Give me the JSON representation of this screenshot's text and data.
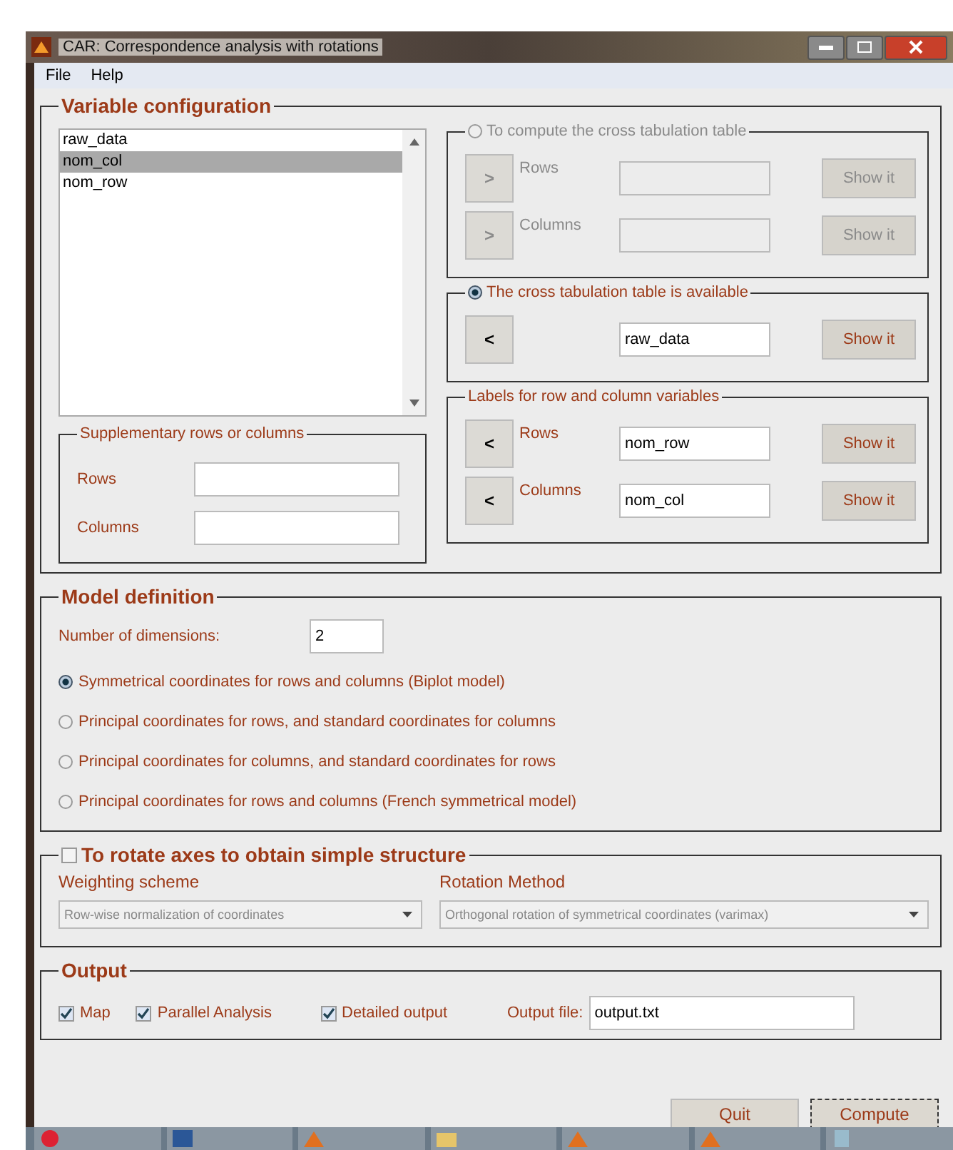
{
  "window": {
    "title": "CAR: Correspondence analysis with rotations"
  },
  "menu": [
    "File",
    "Help"
  ],
  "variable_configuration": {
    "title": "Variable configuration",
    "variables": [
      {
        "name": "raw_data",
        "selected": false
      },
      {
        "name": "nom_col",
        "selected": true
      },
      {
        "name": "nom_row",
        "selected": false
      }
    ],
    "supplementary": {
      "title": "Supplementary rows or columns",
      "fields": [
        {
          "label": "Rows"
        },
        {
          "label": "Columns"
        }
      ]
    },
    "compute_table": {
      "title": "To compute the cross tabulation table",
      "selected": false,
      "rows": [
        {
          "arrow": ">",
          "label": "Rows",
          "button": "Show it"
        },
        {
          "arrow": ">",
          "label": "Columns",
          "button": "Show it"
        }
      ]
    },
    "available_table": {
      "title": "The cross tabulation table is available",
      "selected": true,
      "arrow": "<",
      "value": "raw_data",
      "button": "Show it"
    },
    "labels": {
      "title": "Labels for row and column variables",
      "rows": [
        {
          "arrow": "<",
          "label": "Rows",
          "value": "nom_row",
          "button": "Show it"
        },
        {
          "arrow": "<",
          "label": "Columns",
          "value": "nom_col",
          "button": "Show it"
        }
      ]
    }
  },
  "model_definition": {
    "title": "Model definition",
    "dimensions_label": "Number of dimensions:",
    "dimensions_value": "2",
    "options": [
      {
        "label": "Symmetrical coordinates for rows and columns (Biplot model)",
        "selected": true
      },
      {
        "label": "Principal coordinates for rows, and standard coordinates for columns",
        "selected": false
      },
      {
        "label": "Principal coordinates for columns, and standard coordinates for rows",
        "selected": false
      },
      {
        "label": "Principal coordinates for rows and columns (French symmetrical model)",
        "selected": false
      }
    ]
  },
  "rotation": {
    "title": "To rotate axes to obtain simple structure",
    "checked": false,
    "weighting_label": "Weighting scheme",
    "weighting_value": "Row-wise normalization of coordinates",
    "method_label": "Rotation Method",
    "method_value": "Orthogonal rotation of symmetrical coordinates (varimax)"
  },
  "output": {
    "title": "Output",
    "checks": [
      {
        "label": "Map",
        "checked": true
      },
      {
        "label": "Parallel Analysis",
        "checked": true
      },
      {
        "label": "Detailed output",
        "checked": true
      }
    ],
    "file_label": "Output file:",
    "file_value": "output.txt"
  },
  "buttons": [
    "Quit",
    "Compute"
  ]
}
